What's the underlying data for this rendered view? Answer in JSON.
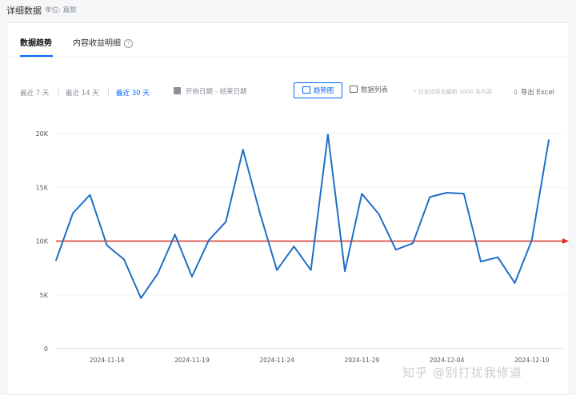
{
  "header": {
    "title": "详细数据",
    "unit": "单位: 篇数"
  },
  "tabs": [
    {
      "label": "数据趋势",
      "active": true
    },
    {
      "label": "内容收益明细",
      "active": false
    }
  ],
  "help_icon_text": "?",
  "toolbar": {
    "ranges": [
      {
        "label": "最近 7 天",
        "active": false
      },
      {
        "label": "最近 14 天",
        "active": false
      },
      {
        "label": "最近 30 天",
        "active": true
      }
    ],
    "date_range": {
      "start": "开始日期",
      "separator": "-",
      "end": "结束日期"
    },
    "view_chart": "趋势图",
    "view_list": "数据列表",
    "hint": "* 仅支持导出最新 1000 条内容",
    "export": "导出 Excel"
  },
  "chart_data": {
    "type": "line",
    "x_tick_labels": [
      "2024-11-14",
      "2024-11-19",
      "2024-11-24",
      "2024-11-29",
      "2024-12-04",
      "2024-12-10"
    ],
    "x_tick_indices": [
      3,
      8,
      13,
      18,
      23,
      28
    ],
    "y_tick_labels": [
      "0",
      "5K",
      "10K",
      "15K",
      "20K"
    ],
    "ylim": [
      0,
      20000
    ],
    "series": [
      {
        "color": "#1f6fc4",
        "values": [
          8200,
          12600,
          14300,
          9600,
          8300,
          4700,
          7000,
          10600,
          6700,
          10100,
          11800,
          18500,
          12600,
          7300,
          9500,
          7300,
          19900,
          7200,
          14400,
          12500,
          9200,
          9800,
          14100,
          14500,
          14400,
          8100,
          8500,
          6100,
          10100,
          19400
        ]
      }
    ],
    "reference_line": {
      "value": 10000,
      "color": "#d93025"
    },
    "grid": true
  },
  "watermark": "知乎 @别打扰我修道"
}
